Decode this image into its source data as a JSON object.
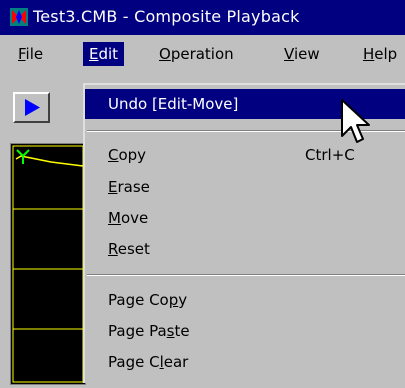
{
  "window": {
    "title": "Test3.CMB - Composite Playback"
  },
  "menubar": {
    "items": [
      {
        "prefix": "",
        "u": "F",
        "rest": "ile"
      },
      {
        "prefix": "",
        "u": "E",
        "rest": "dit"
      },
      {
        "prefix": "",
        "u": "O",
        "rest": "peration"
      },
      {
        "prefix": "",
        "u": "V",
        "rest": "iew"
      },
      {
        "prefix": "",
        "u": "H",
        "rest": "elp"
      }
    ]
  },
  "edit_menu": {
    "undo": "Undo [Edit-Move]",
    "copy": {
      "u": "C",
      "rest": "opy",
      "shortcut": "Ctrl+C"
    },
    "erase": {
      "u": "E",
      "rest": "rase"
    },
    "move": {
      "u": "M",
      "rest": "ove"
    },
    "reset": {
      "u": "R",
      "rest": "eset"
    },
    "page_copy": {
      "prefix": "Page Co",
      "u": "p",
      "rest": "y"
    },
    "page_paste": {
      "prefix": "Page Pa",
      "u": "s",
      "rest": "te"
    },
    "page_clear": {
      "prefix": "Page C",
      "u": "l",
      "rest": "ear"
    }
  },
  "colors": {
    "title_bg": "#000080",
    "highlight": "#000080",
    "face": "#c0c0c0",
    "play": "#0000ff",
    "trace": "#ffff00"
  },
  "icons": {
    "app": "app-icon",
    "play": "play-icon",
    "cursor": "mouse-pointer-icon"
  }
}
